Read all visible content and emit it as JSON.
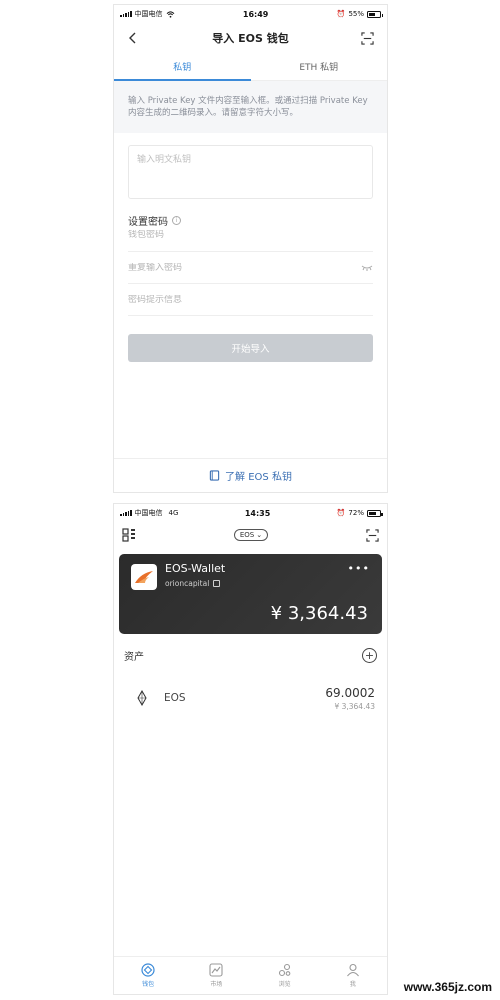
{
  "screen1": {
    "status": {
      "carrier": "中国电信",
      "time": "16:49",
      "battery": "55%",
      "battery_level": 0.55
    },
    "title": "导入 EOS 钱包",
    "tabs": [
      {
        "label": "私钥",
        "active": true
      },
      {
        "label": "ETH 私钥",
        "active": false
      }
    ],
    "hint": "输入 Private Key 文件内容至输入框。或通过扫描 Private Key 内容生成的二维码录入。请留意字符大小写。",
    "private_key_placeholder": "输入明文私钥",
    "password_section_title": "设置密码",
    "password_placeholder": "钱包密码",
    "repeat_password_placeholder": "重复输入密码",
    "password_hint_placeholder": "密码提示信息",
    "import_button": "开始导入",
    "learn_link": "了解 EOS 私钥"
  },
  "screen2": {
    "status": {
      "carrier": "中国电信",
      "network": "4G",
      "time": "14:35",
      "battery": "72%",
      "battery_level": 0.72
    },
    "network_selector": "EOS",
    "wallet": {
      "name": "EOS-Wallet",
      "account": "orioncapital",
      "balance": "¥ 3,364.43"
    },
    "assets_title": "资产",
    "assets": [
      {
        "symbol": "EOS",
        "amount": "69.0002",
        "value": "¥ 3,364.43"
      }
    ],
    "bottom_tabs": [
      {
        "label": "钱包",
        "icon": "wallet-icon",
        "active": true
      },
      {
        "label": "市场",
        "icon": "market-icon",
        "active": false
      },
      {
        "label": "浏览",
        "icon": "browse-icon",
        "active": false
      },
      {
        "label": "我",
        "icon": "profile-icon",
        "active": false
      }
    ]
  },
  "watermark": "www.365jz.com",
  "colors": {
    "accent": "#3b8ad8",
    "link": "#3b6fb3",
    "card": "#2b2b2b",
    "disabled_button": "#c8ccd1"
  }
}
